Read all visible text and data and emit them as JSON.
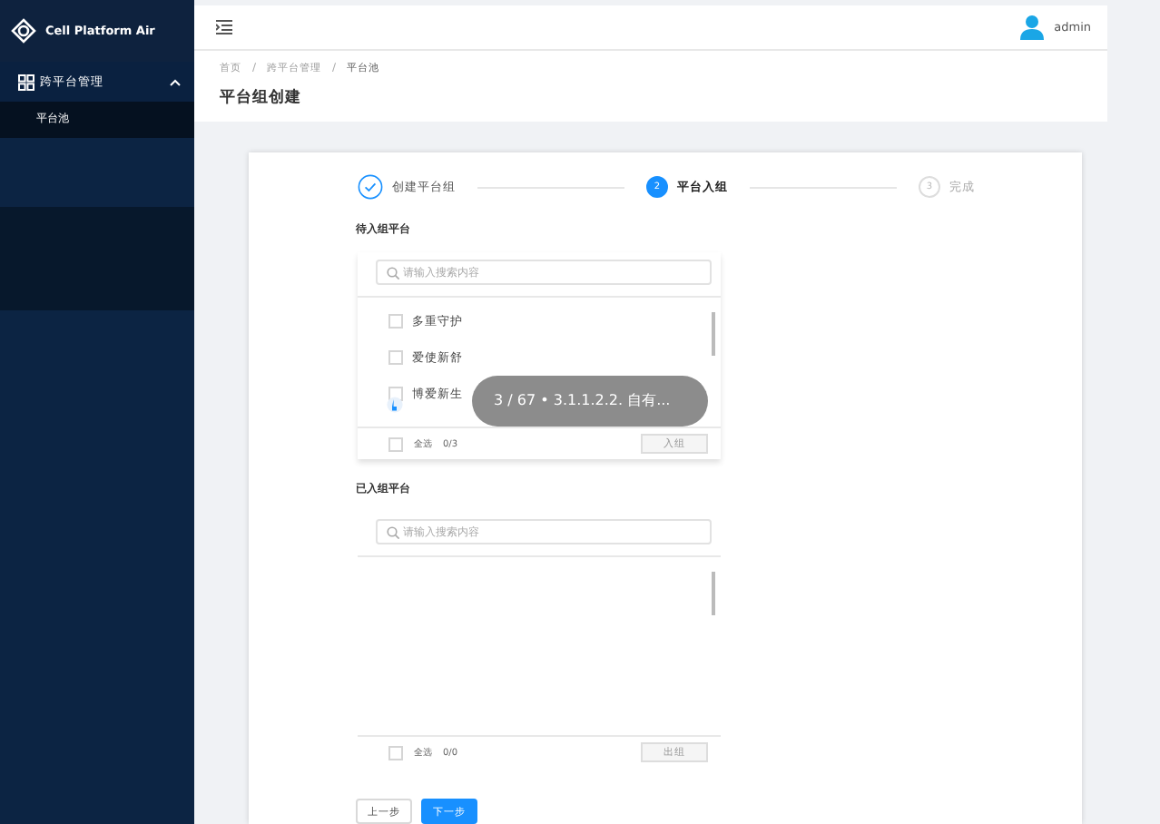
{
  "sidebar": {
    "brand": "Cell Platform Air",
    "menu": [
      {
        "label": "跨平台管理",
        "expanded": true,
        "children": [
          {
            "label": "平台池",
            "selected": true
          }
        ]
      }
    ]
  },
  "header": {
    "user": "admin"
  },
  "breadcrumb": [
    {
      "label": "首页"
    },
    {
      "separator": "/",
      "label": "跨平台管理"
    },
    {
      "separator": "/",
      "label": "平台池"
    }
  ],
  "page_title": "平台组创建",
  "steps": [
    {
      "label": "创建平台组",
      "finished": true,
      "selected": false
    },
    {
      "index": "2",
      "label": "平台入组",
      "finished": false,
      "selected": true
    },
    {
      "index": "3",
      "label": "完成",
      "finished": false,
      "selected": false
    }
  ],
  "panels": [
    {
      "title": "待入组平台",
      "placeholder": "请输入搜索内容",
      "items": [
        {
          "label": "多重守护",
          "checked": false
        },
        {
          "label": "爱使新舒",
          "checked": false
        },
        {
          "label": "博爱新生",
          "checked": false
        }
      ],
      "select_all": "全选",
      "select_all_checked": false,
      "count": "0/3",
      "action": "入组"
    },
    {
      "title": "已入组平台",
      "placeholder": "请输入搜索内容",
      "select_all": "全选",
      "select_all_checked": false,
      "count": "0/0",
      "action": "出组"
    }
  ],
  "buttons": [
    {
      "label": "上一步",
      "kind": "default"
    },
    {
      "label": "下一步",
      "kind": "primary"
    }
  ],
  "toast": "3 / 67 • 3.1.1.2.2. 自有..."
}
